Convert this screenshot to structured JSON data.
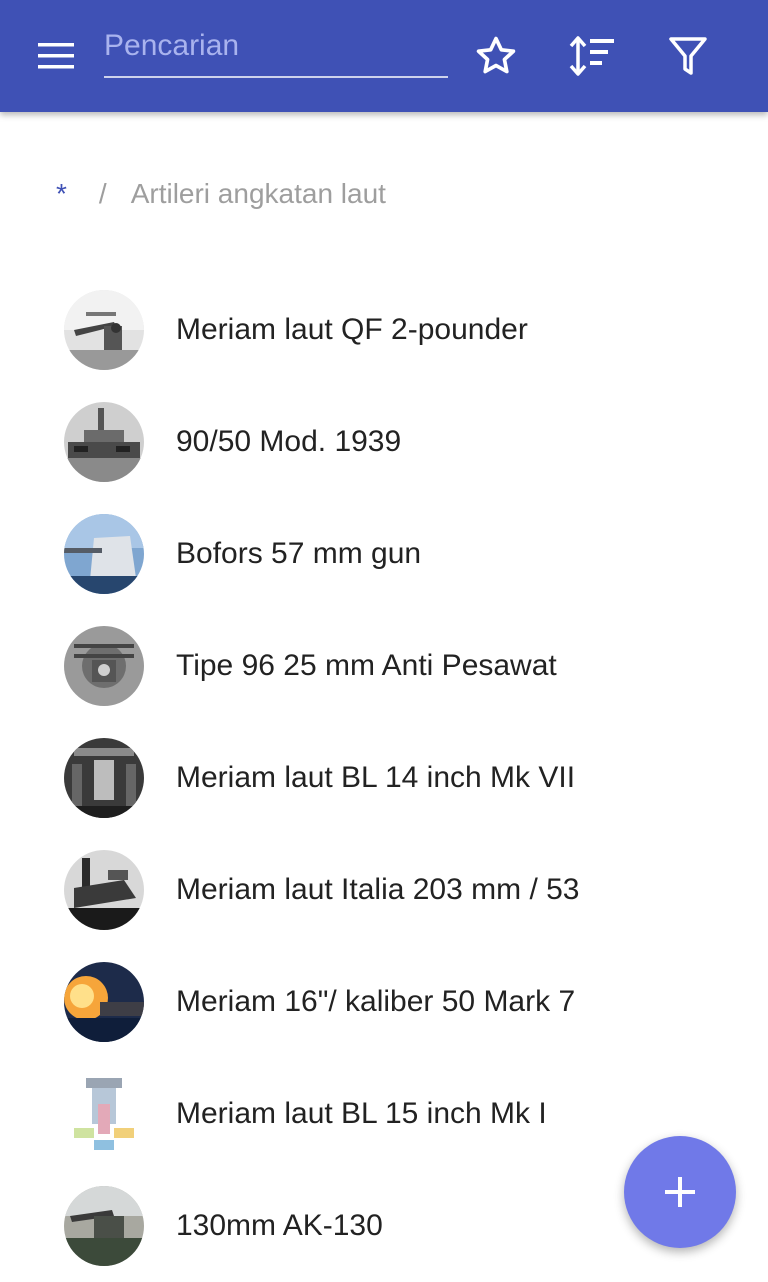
{
  "appbar": {
    "color": "#3f51b5",
    "menu_icon": "menu-icon",
    "search_placeholder": "Pencarian",
    "search_value": "",
    "actions": [
      "star-icon",
      "sort-icon",
      "filter-icon"
    ]
  },
  "breadcrumb": {
    "root": "*",
    "separator": "/",
    "current": "Artileri angkatan laut"
  },
  "items": [
    {
      "label": "Meriam laut QF 2-pounder"
    },
    {
      "label": "90/50 Mod. 1939"
    },
    {
      "label": "Bofors 57 mm gun"
    },
    {
      "label": "Tipe 96 25 mm Anti Pesawat"
    },
    {
      "label": "Meriam laut BL 14 inch Mk VII"
    },
    {
      "label": "Meriam laut Italia 203 mm / 53"
    },
    {
      "label": "Meriam 16\"/ kaliber 50 Mark 7"
    },
    {
      "label": "Meriam laut BL 15 inch Mk I"
    },
    {
      "label": "130mm AK-130"
    }
  ],
  "fab": {
    "icon": "add-icon",
    "color": "#7079e8"
  }
}
